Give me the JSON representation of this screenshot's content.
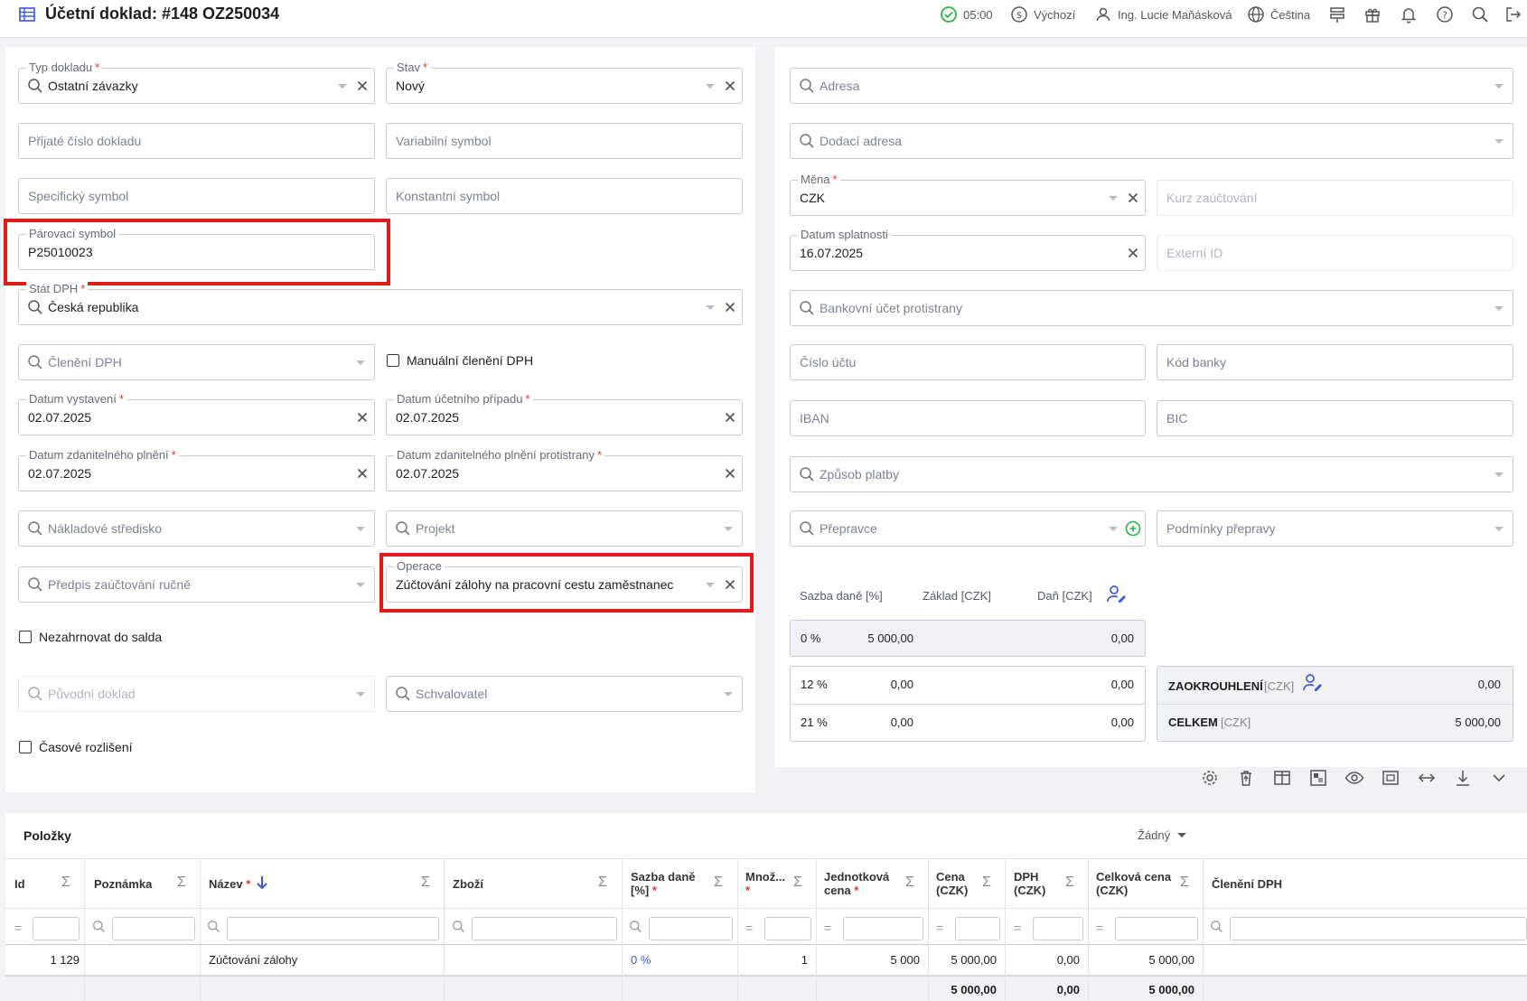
{
  "header": {
    "title": "Účetní doklad: #148 OZ250034",
    "time": "05:00",
    "profile": "Výchozí",
    "user": "Ing. Lucie Maňásková",
    "language": "Čeština"
  },
  "left": {
    "typ_dokladu": {
      "label": "Typ dokladu",
      "value": "Ostatní závazky"
    },
    "stav": {
      "label": "Stav",
      "value": "Nový"
    },
    "prijate_cislo": {
      "placeholder": "Přijaté číslo dokladu"
    },
    "variabilni": {
      "placeholder": "Variabilní symbol"
    },
    "specificky": {
      "placeholder": "Specifický symbol"
    },
    "konstantni": {
      "placeholder": "Konstantní symbol"
    },
    "parovaci": {
      "label": "Párovací symbol",
      "value": "P25010023"
    },
    "stat_dph": {
      "label": "Stát DPH",
      "value": "Česká republika"
    },
    "cleneni_dph": {
      "placeholder": "Členění DPH"
    },
    "manualni_cleneni": {
      "label": "Manuální členění DPH"
    },
    "datum_vystaveni": {
      "label": "Datum vystavení",
      "value": "02.07.2025"
    },
    "datum_ucetniho": {
      "label": "Datum účetního případu",
      "value": "02.07.2025"
    },
    "datum_zdanitelneho": {
      "label": "Datum zdanitelného plnění",
      "value": "02.07.2025"
    },
    "datum_zdanitelneho_protistrany": {
      "label": "Datum zdanitelného plnění protistrany",
      "value": "02.07.2025"
    },
    "nakladove_stredisko": {
      "placeholder": "Nákladové středisko"
    },
    "projekt": {
      "placeholder": "Projekt"
    },
    "predpis": {
      "placeholder": "Předpis zaúčtování ručně"
    },
    "operace": {
      "label": "Operace",
      "value": "Zúčtování zálohy na pracovní cestu zaměstnanec"
    },
    "nezahrnovat": {
      "label": "Nezahrnovat do salda"
    },
    "puvodni_doklad": {
      "placeholder": "Původní doklad"
    },
    "schvalovatel": {
      "placeholder": "Schvalovatel"
    },
    "casove_rozliseni": {
      "label": "Časové rozlišení"
    }
  },
  "right": {
    "adresa": {
      "placeholder": "Adresa"
    },
    "dodaci_adresa": {
      "placeholder": "Dodací adresa"
    },
    "mena": {
      "label": "Měna",
      "value": "CZK"
    },
    "kurz": {
      "placeholder": "Kurz zaúčtování"
    },
    "datum_splatnosti": {
      "label": "Datum splatnosti",
      "value": "16.07.2025"
    },
    "externi_id": {
      "placeholder": "Externí ID"
    },
    "bankovni_ucet": {
      "placeholder": "Bankovní účet protistrany"
    },
    "cislo_uctu": {
      "placeholder": "Číslo účtu"
    },
    "kod_banky": {
      "placeholder": "Kód banky"
    },
    "iban": {
      "placeholder": "IBAN"
    },
    "bic": {
      "placeholder": "BIC"
    },
    "zpusob_platby": {
      "placeholder": "Způsob platby"
    },
    "prepravce": {
      "placeholder": "Přepravce"
    },
    "podminky_prepravy": {
      "placeholder": "Podmínky přepravy"
    },
    "vat": {
      "headers": {
        "rate": "Sazba daně [%]",
        "base": "Základ [CZK]",
        "tax": "Daň [CZK]"
      },
      "rows": [
        {
          "rate": "0 %",
          "base": "5 000,00",
          "tax": "0,00"
        },
        {
          "rate": "12 %",
          "base": "0,00",
          "tax": "0,00"
        },
        {
          "rate": "21 %",
          "base": "0,00",
          "tax": "0,00"
        }
      ],
      "rounding": {
        "label": "ZAOKROUHLENÍ",
        "unit": "[CZK]",
        "value": "0,00"
      },
      "total": {
        "label": "CELKEM",
        "unit": "[CZK]",
        "value": "5 000,00"
      }
    }
  },
  "items": {
    "title": "Položky",
    "grouping": "Žádný",
    "columns": {
      "id": "Id",
      "note": "Poznámka",
      "name": "Název",
      "goods": "Zboží",
      "vat_rate_1": "Sazba daně",
      "vat_rate_2": "[%]",
      "qty_1": "Množ...",
      "unit_price_1": "Jednotková",
      "unit_price_2": "cena",
      "price_1": "Cena",
      "price_2": "(CZK)",
      "vat_1": "DPH",
      "vat_2": "(CZK)",
      "total_1": "Celková cena",
      "total_2": "(CZK)",
      "vat_breakdown": "Členění DPH"
    },
    "row": {
      "id": "1 129",
      "name": "Zúčtování zálohy",
      "vat_rate": "0 %",
      "qty": "1",
      "unit_price": "5 000",
      "price": "5 000,00",
      "vat": "0,00",
      "total": "5 000,00"
    },
    "sums": {
      "price": "5 000,00",
      "vat": "0,00",
      "total": "5 000,00"
    }
  },
  "colors": {
    "accent": "#3b56d6",
    "required": "#e2332a",
    "success": "#2bb34a",
    "highlight": "#e01b1b"
  }
}
